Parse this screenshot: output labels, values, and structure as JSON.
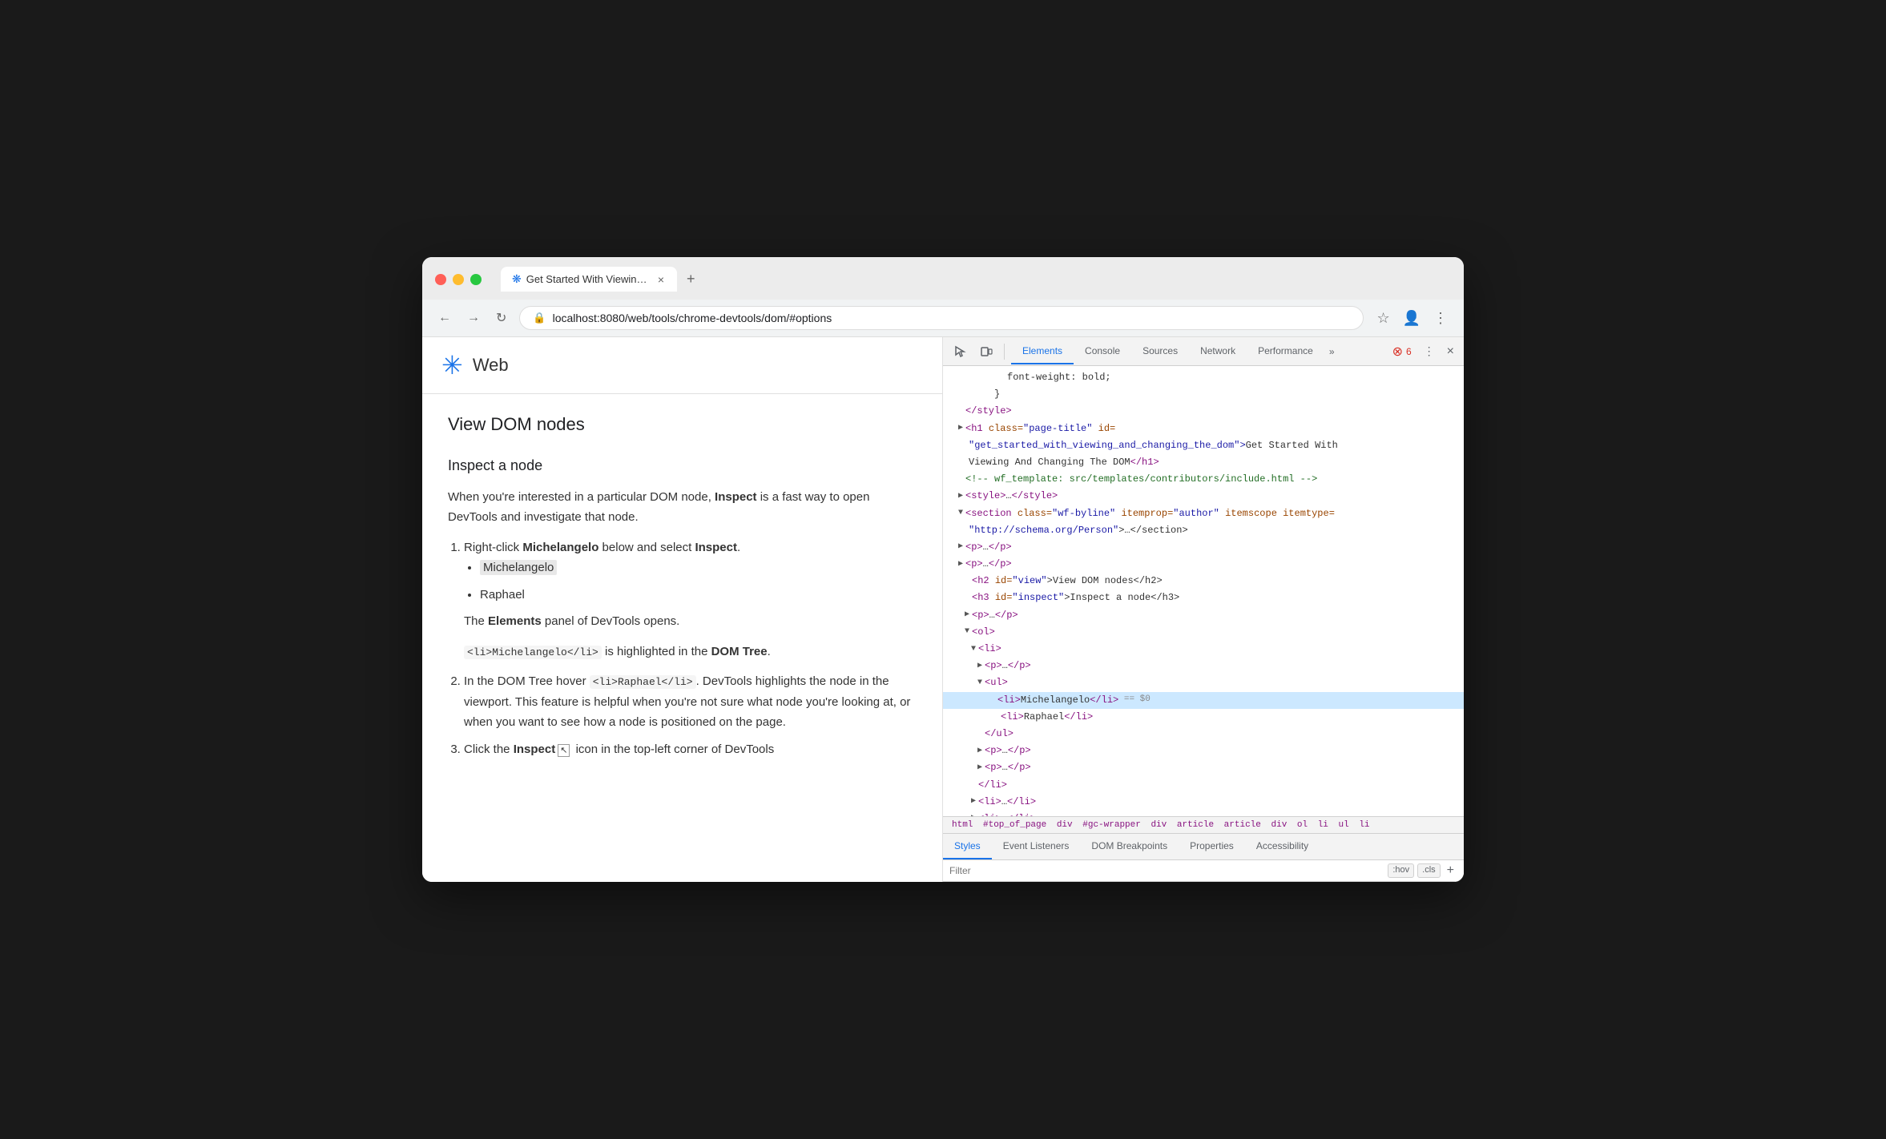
{
  "browser": {
    "traffic_lights": [
      "red",
      "yellow",
      "green"
    ],
    "tab_title": "Get Started With Viewing And",
    "tab_favicon": "❋",
    "new_tab_label": "+",
    "address_bar": {
      "url": "localhost:8080/web/tools/chrome-devtools/dom/#options",
      "lock_icon": "🔒"
    },
    "nav": {
      "back": "←",
      "forward": "→",
      "reload": "↻"
    },
    "toolbar_icons": [
      "☆",
      "👤",
      "⋮"
    ]
  },
  "page": {
    "logo": "❋",
    "site_name": "Web",
    "article": {
      "h2": "View DOM nodes",
      "h3": "Inspect a node",
      "intro": "When you're interested in a particular DOM node,",
      "inspect_bold": "Inspect",
      "intro2": "is a fast way to open DevTools and investigate that node.",
      "steps": [
        {
          "num": 1,
          "text_before": "Right-click",
          "bold1": "Michelangelo",
          "text_mid": "below and select",
          "bold2": "Inspect",
          "text_end": ".",
          "sub_items": [
            "Michelangelo",
            "Raphael"
          ],
          "note1": "The",
          "note1_bold": "Elements",
          "note1_end": "panel of DevTools opens.",
          "note2_code": "<li>Michelangelo</li>",
          "note2_end": "is highlighted in the",
          "note2_bold": "DOM Tree",
          "note2_end2": "."
        },
        {
          "num": 2,
          "text_before": "In the DOM Tree hover",
          "code": "<li>Raphael</li>",
          "text_end": ". DevTools highlights the node in the viewport. This feature is helpful when you're not sure what node you're looking at, or when you want to see how a node is positioned on the page."
        },
        {
          "num": 3,
          "text_before": "Click the",
          "bold": "Inspect",
          "text_end": "icon in the top-left corner of DevTools"
        }
      ]
    }
  },
  "devtools": {
    "inspect_icon": "↖",
    "device_icon": "⬜",
    "tabs": [
      "Elements",
      "Console",
      "Sources",
      "Network",
      "Performance"
    ],
    "more_tabs": "»",
    "error_count": "6",
    "close": "×",
    "more_options": "⋮",
    "dom_lines": [
      {
        "indent": 8,
        "content": "font-weight: bold;",
        "type": "css"
      },
      {
        "indent": 8,
        "content": "}",
        "type": "css"
      },
      {
        "indent": 4,
        "triangle": "none",
        "content": "</style>",
        "type": "tag-close"
      },
      {
        "indent": 4,
        "triangle": "closed",
        "content": "<h1 class=\"page-title\" id=",
        "type": "tag"
      },
      {
        "indent": 4,
        "content": "\"get_started_with_viewing_and_changing_the_dom\">Get Started With",
        "type": "attr-value"
      },
      {
        "indent": 4,
        "content": "Viewing And Changing The DOM</h1>",
        "type": "text"
      },
      {
        "indent": 4,
        "content": "<!-- wf_template: src/templates/contributors/include.html -->",
        "type": "comment"
      },
      {
        "indent": 4,
        "triangle": "closed",
        "content": "<style>…</style>",
        "type": "tag"
      },
      {
        "indent": 4,
        "triangle": "open",
        "content": "<section class=\"wf-byline\" itemprop=\"author\" itemscope itemtype=",
        "type": "tag"
      },
      {
        "indent": 4,
        "content": "\"http://schema.org/Person\">…</section>",
        "type": "attr-value"
      },
      {
        "indent": 4,
        "triangle": "closed",
        "content": "<p>…</p>",
        "type": "tag"
      },
      {
        "indent": 4,
        "triangle": "closed",
        "content": "<p>…</p>",
        "type": "tag"
      },
      {
        "indent": 6,
        "triangle": "none",
        "content": "<h2 id=\"view\">View DOM nodes</h2>",
        "type": "tag"
      },
      {
        "indent": 6,
        "triangle": "none",
        "content": "<h3 id=\"inspect\">Inspect a node</h3>",
        "type": "tag"
      },
      {
        "indent": 6,
        "triangle": "closed",
        "content": "<p>…</p>",
        "type": "tag"
      },
      {
        "indent": 6,
        "triangle": "open",
        "content": "<ol>",
        "type": "tag"
      },
      {
        "indent": 8,
        "triangle": "open",
        "content": "<li>",
        "type": "tag"
      },
      {
        "indent": 10,
        "triangle": "closed",
        "content": "<p>…</p>",
        "type": "tag"
      },
      {
        "indent": 10,
        "triangle": "open",
        "content": "<ul>",
        "type": "tag"
      },
      {
        "indent": 12,
        "content": "<li>Michelangelo</li> == $0",
        "type": "selected"
      },
      {
        "indent": 14,
        "content": "<li>Raphael</li>",
        "type": "tag"
      },
      {
        "indent": 10,
        "content": "</ul>",
        "type": "tag-close"
      },
      {
        "indent": 10,
        "triangle": "closed",
        "content": "<p>…</p>",
        "type": "tag"
      },
      {
        "indent": 10,
        "triangle": "closed",
        "content": "<p>…</p>",
        "type": "tag"
      },
      {
        "indent": 8,
        "content": "</li>",
        "type": "tag-close"
      },
      {
        "indent": 8,
        "triangle": "closed",
        "content": "<li>…</li>",
        "type": "tag"
      },
      {
        "indent": 8,
        "triangle": "closed",
        "content": "<li>…</li>",
        "type": "tag"
      }
    ],
    "breadcrumb": [
      "html",
      "#top_of_page",
      "div",
      "#gc-wrapper",
      "div",
      "article",
      "article",
      "div",
      "ol",
      "li",
      "ul",
      "li"
    ],
    "bottom_tabs": [
      "Styles",
      "Event Listeners",
      "DOM Breakpoints",
      "Properties",
      "Accessibility"
    ],
    "filter_placeholder": "Filter",
    "filter_hov": ":hov",
    "filter_cls": ".cls",
    "filter_add": "+"
  }
}
